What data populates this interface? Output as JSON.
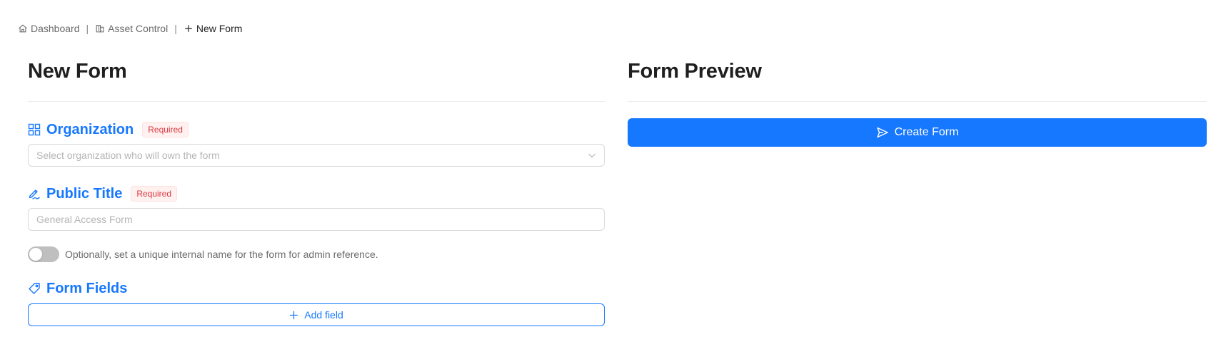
{
  "breadcrumb": {
    "items": [
      {
        "label": "Dashboard",
        "icon": "home-icon"
      },
      {
        "label": "Asset Control",
        "icon": "building-icon"
      },
      {
        "label": "New Form",
        "icon": "plus-icon"
      }
    ],
    "separator": "|"
  },
  "left": {
    "title": "New Form",
    "organization": {
      "label": "Organization",
      "badge": "Required",
      "placeholder": "Select organization who will own the form",
      "icon": "grid-icon"
    },
    "public_title": {
      "label": "Public Title",
      "badge": "Required",
      "placeholder": "General Access Form",
      "icon": "signature-icon"
    },
    "internal_name_toggle": {
      "label": "Optionally, set a unique internal name for the form for admin reference.",
      "checked": false
    },
    "form_fields": {
      "label": "Form Fields",
      "icon": "tag-icon",
      "add_label": "Add field"
    }
  },
  "right": {
    "title": "Form Preview",
    "create_label": "Create Form",
    "create_icon": "send-icon"
  },
  "colors": {
    "accent": "#1677ff",
    "required": "#d9363e",
    "required_bg": "#fff1f0"
  }
}
